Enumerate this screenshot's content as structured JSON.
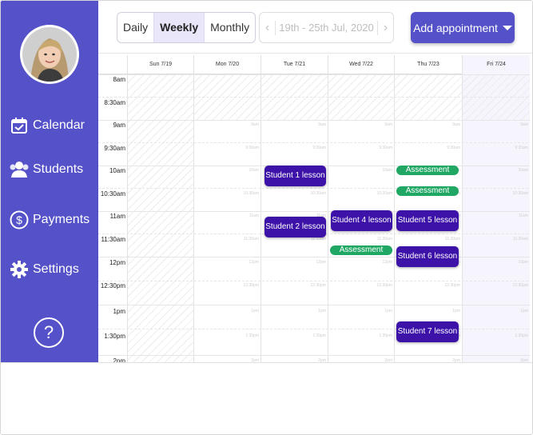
{
  "sidebar": {
    "items": [
      {
        "label": "Calendar",
        "icon": "calendar-check-icon"
      },
      {
        "label": "Students",
        "icon": "users-icon"
      },
      {
        "label": "Payments",
        "icon": "dollar-circle-icon"
      },
      {
        "label": "Settings",
        "icon": "gear-icon"
      }
    ],
    "help_label": "?"
  },
  "toolbar": {
    "views": [
      "Daily",
      "Weekly",
      "Monthly"
    ],
    "active_view": "Weekly",
    "date_range": "19th - 25th Jul, 2020",
    "add_label": "Add appointment"
  },
  "calendar": {
    "days": [
      "Sun 7/19",
      "Mon 7/20",
      "Tue 7/21",
      "Wed 7/22",
      "Thu 7/23",
      "Fri 7/24"
    ],
    "times": [
      "8am",
      "8:30am",
      "9am",
      "9:30am",
      "10am",
      "10:30am",
      "11am",
      "11:30am",
      "12pm",
      "12:30pm",
      "1pm",
      "1:30pm",
      "2pm"
    ],
    "slot_labels": [
      "9am",
      "9:30am",
      "10am",
      "10:30am",
      "11am",
      "11:30am",
      "12pm",
      "12:30pm",
      "1pm",
      "1:30pm",
      "2pm"
    ],
    "appointments": {
      "s1": "Student 1 lesson",
      "s2": "Student 2 lesson",
      "s4": "Student 4 lesson",
      "s5": "Student 5 lesson",
      "s6": "Student 6 lesson",
      "s7": "Student 7 lesson",
      "a1": "Assessment",
      "a2": "Assessment",
      "a3": "Assessment"
    }
  },
  "colors": {
    "brand": "#5552c9",
    "lesson": "#3c12a8",
    "assessment": "#1fa763"
  }
}
